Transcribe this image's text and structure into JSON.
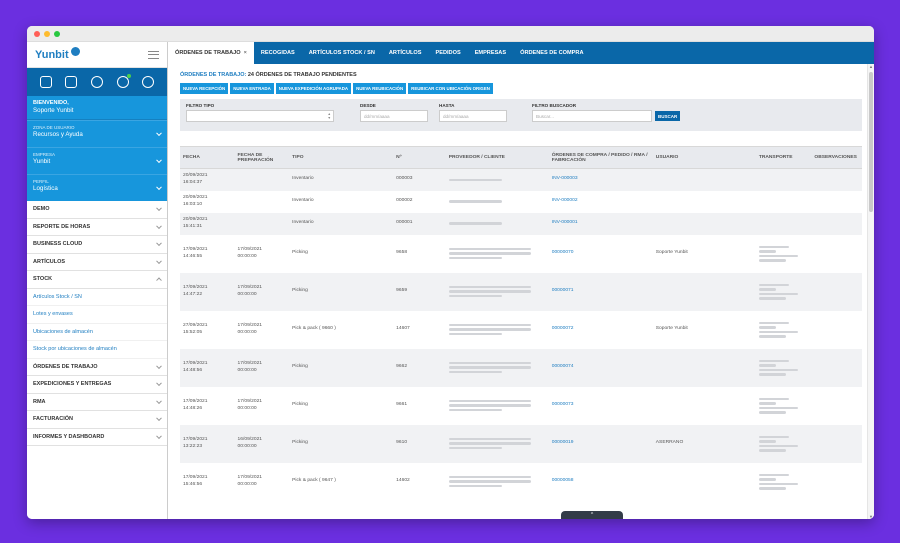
{
  "colors": {
    "background": "#6b2fe0",
    "primary": "#0a67a8",
    "accent": "#1796dc",
    "link": "#1f7ec1"
  },
  "sidebar": {
    "logo": "Yunbit",
    "icons": [
      "expand-icon",
      "wordpress-icon",
      "settings-icon",
      "clock-icon",
      "logout-icon"
    ],
    "welcome_label": "BIENVENIDO,",
    "user_name": "Soporte Yunbit",
    "selects": [
      {
        "label": "ZONA DE USUARIO",
        "value": "Recursos y Ayuda"
      },
      {
        "label": "EMPRESA",
        "value": "Yunbit"
      },
      {
        "label": "PERFIL",
        "value": "Logística"
      }
    ],
    "items_top": [
      {
        "label": "DEMO"
      },
      {
        "label": "REPORTE DE HORAS"
      },
      {
        "label": "BUSINESS CLOUD"
      },
      {
        "label": "ARTÍCULOS"
      },
      {
        "label": "STOCK"
      }
    ],
    "subitems": [
      {
        "label": "Artículos Stock / SN"
      },
      {
        "label": "Lotes y envases"
      },
      {
        "label": "Ubicaciones de almacén"
      },
      {
        "label": "Stock por ubicaciones de almacén"
      }
    ],
    "items_bottom": [
      {
        "label": "ÓRDENES DE TRABAJO"
      },
      {
        "label": "EXPEDICIONES Y ENTREGAS"
      },
      {
        "label": "RMA"
      },
      {
        "label": "FACTURACIÓN"
      },
      {
        "label": "INFORMES Y DASHBOARD"
      }
    ]
  },
  "tabs": [
    {
      "label": "ÓRDENES DE TRABAJO",
      "close": "×"
    },
    {
      "label": "RECOGIDAS"
    },
    {
      "label": "ARTÍCULOS STOCK / SN"
    },
    {
      "label": "ARTÍCULOS"
    },
    {
      "label": "PEDIDOS"
    },
    {
      "label": "EMPRESAS"
    },
    {
      "label": "ÓRDENES DE COMPRA"
    }
  ],
  "page": {
    "title_prefix": "ÓRDENES DE TRABAJO:",
    "title_rest": "24 ÓRDENES DE TRABAJO PENDIENTES"
  },
  "buttons": [
    {
      "label": "NUEVA RECEPCIÓN"
    },
    {
      "label": "NUEVA ENTRADA"
    },
    {
      "label": "NUEVA EXPEDICIÓN AGRUPADA"
    },
    {
      "label": "NUEVA REUBICACIÓN"
    },
    {
      "label": "REUBICAR CON UBICACIÓN ORIGEN"
    }
  ],
  "filters": {
    "tipo_label": "FILTRO TIPO",
    "desde_label": "DESDE",
    "desde_placeholder": "dd/mm/aaaa",
    "hasta_label": "HASTA",
    "hasta_placeholder": "dd/mm/aaaa",
    "buscador_label": "FILTRO BUSCADOR",
    "buscador_placeholder": "Buscar...",
    "search_button": "BUSCAR"
  },
  "table": {
    "headers": [
      "FECHA",
      "FECHA DE PREPARACIÓN",
      "TIPO",
      "Nº",
      "PROVEEDOR / CLIENTE",
      "ÓRDENES DE COMPRA / PEDIDO / RMA / FABRICACIÓN",
      "USUARIO",
      "TRANSPORTE",
      "OBSERVACIONES"
    ],
    "rows": [
      {
        "fecha": "20/09/2021",
        "hora": "16:04:37",
        "prep": "",
        "prep_hora": "",
        "tipo": "Inventario",
        "num": "000003",
        "order": "INV-000003",
        "usuario": ""
      },
      {
        "fecha": "20/09/2021",
        "hora": "16:03:10",
        "prep": "",
        "prep_hora": "",
        "tipo": "Inventario",
        "num": "000002",
        "order": "INV-000002",
        "usuario": ""
      },
      {
        "fecha": "20/09/2021",
        "hora": "15:41:31",
        "prep": "",
        "prep_hora": "",
        "tipo": "Inventario",
        "num": "000001",
        "order": "INV-000001",
        "usuario": ""
      },
      {
        "fecha": "17/09/2021",
        "hora": "14:46:55",
        "prep": "17/09/2021",
        "prep_hora": "00:00:00",
        "tipo": "Picking",
        "num": "9658",
        "order": "00000070",
        "usuario": "Soporte Yunbit"
      },
      {
        "fecha": "17/09/2021",
        "hora": "14:47:22",
        "prep": "17/09/2021",
        "prep_hora": "00:00:00",
        "tipo": "Picking",
        "num": "9659",
        "order": "00000071",
        "usuario": ""
      },
      {
        "fecha": "27/09/2021",
        "hora": "15:52:05",
        "prep": "17/09/2021",
        "prep_hora": "00:00:00",
        "tipo": "Pick & pack ( 9660 )",
        "num": "14607",
        "order": "00000072",
        "usuario": "Soporte Yunbit"
      },
      {
        "fecha": "17/09/2021",
        "hora": "14:48:56",
        "prep": "17/09/2021",
        "prep_hora": "00:00:00",
        "tipo": "Picking",
        "num": "9662",
        "order": "00000074",
        "usuario": ""
      },
      {
        "fecha": "17/09/2021",
        "hora": "14:48:26",
        "prep": "17/09/2021",
        "prep_hora": "00:00:00",
        "tipo": "Picking",
        "num": "9661",
        "order": "00000073",
        "usuario": ""
      },
      {
        "fecha": "17/09/2021",
        "hora": "13:22:23",
        "prep": "16/09/2021",
        "prep_hora": "00:00:00",
        "tipo": "Picking",
        "num": "9610",
        "order": "00000019",
        "usuario": "ASERRANO"
      },
      {
        "fecha": "17/09/2021",
        "hora": "15:46:56",
        "prep": "17/09/2021",
        "prep_hora": "00:00:00",
        "tipo": "Pick & pack ( 9647 )",
        "num": "14602",
        "order": "00000058",
        "usuario": ""
      }
    ]
  }
}
